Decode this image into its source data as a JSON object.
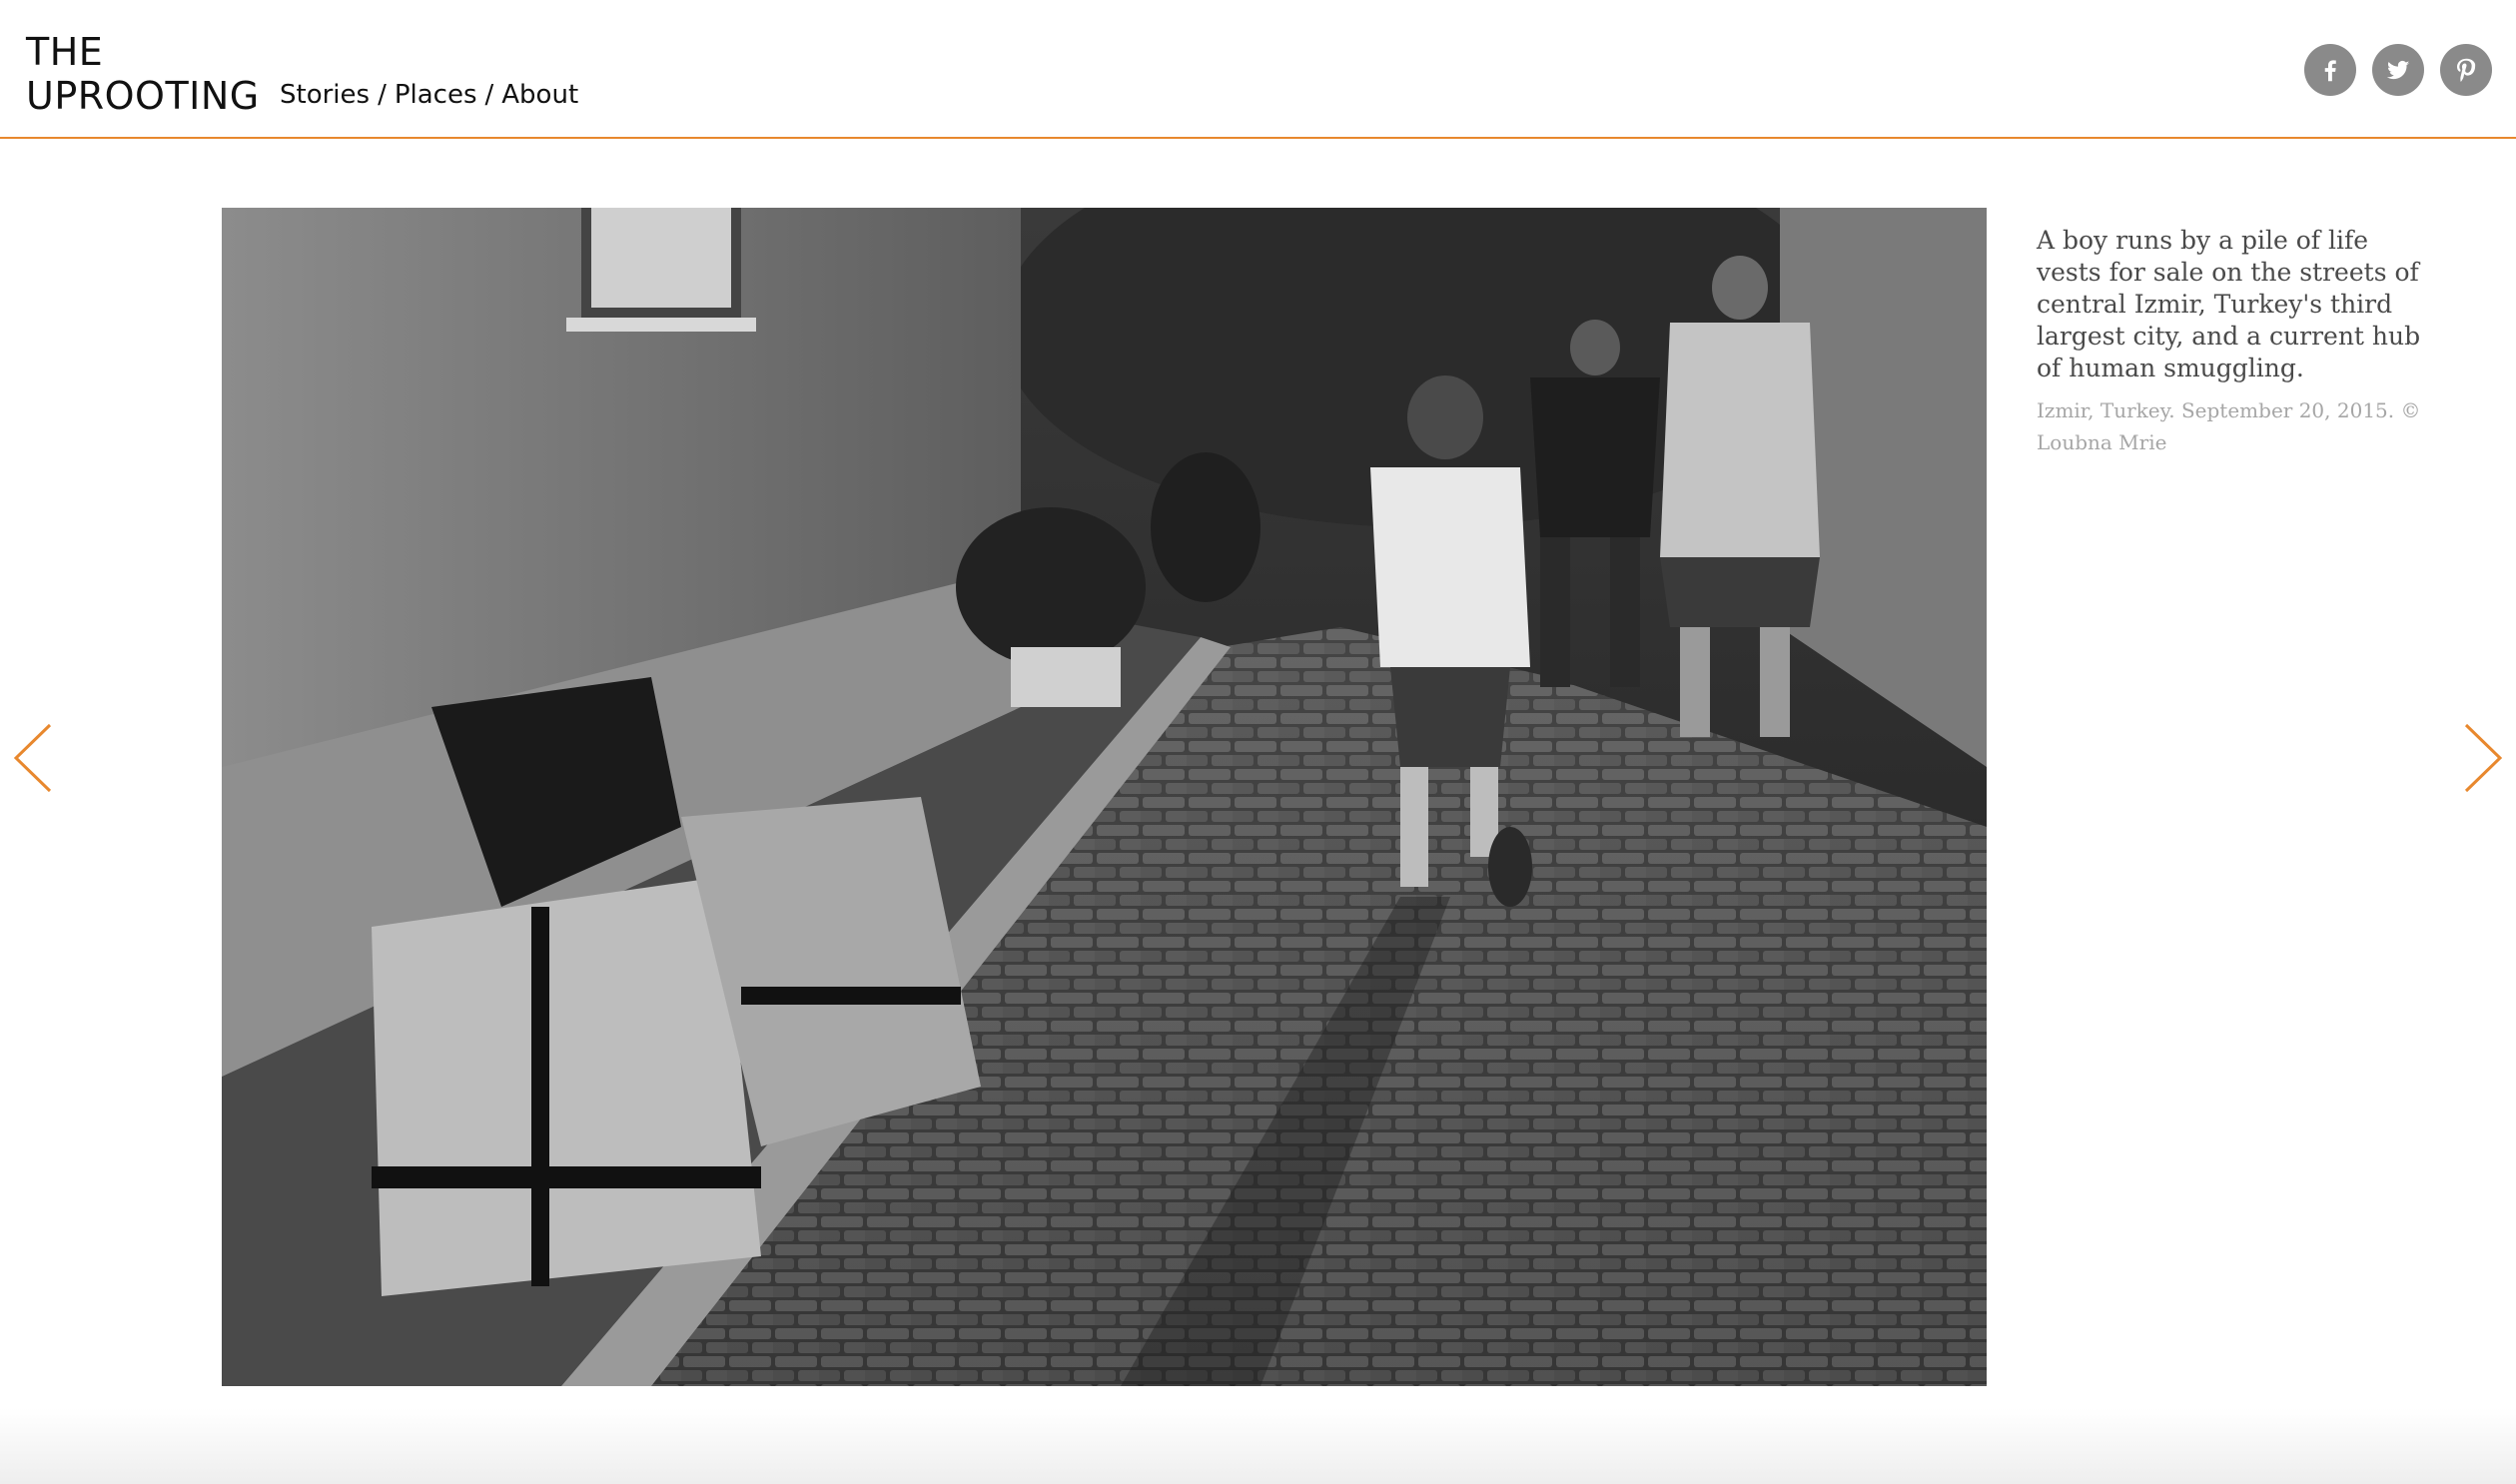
{
  "site": {
    "logo_line1": "THE",
    "logo_line2": "UPROOTING"
  },
  "nav": {
    "items": [
      "Stories",
      "Places",
      "About"
    ],
    "separator": "/"
  },
  "social": {
    "icons": [
      "facebook-icon",
      "twitter-icon",
      "pinterest-icon"
    ],
    "icon_color": "#8a8a8a"
  },
  "photo": {
    "description_icon": "photo-image"
  },
  "caption": {
    "text": "A boy runs by a pile of life vests for sale on the streets of central Izmir, Turkey's third largest city, and a current hub of human smuggling.",
    "credit": "Izmir, Turkey. September 20, 2015. © Loubna Mrie"
  },
  "arrows": {
    "left_icon": "chevron-left-icon",
    "right_icon": "chevron-right-icon",
    "color": "#e8882e"
  },
  "colors": {
    "accent": "#e8882e",
    "text": "#111111",
    "caption": "#4a4a4a",
    "credit": "#a6a6a6"
  }
}
